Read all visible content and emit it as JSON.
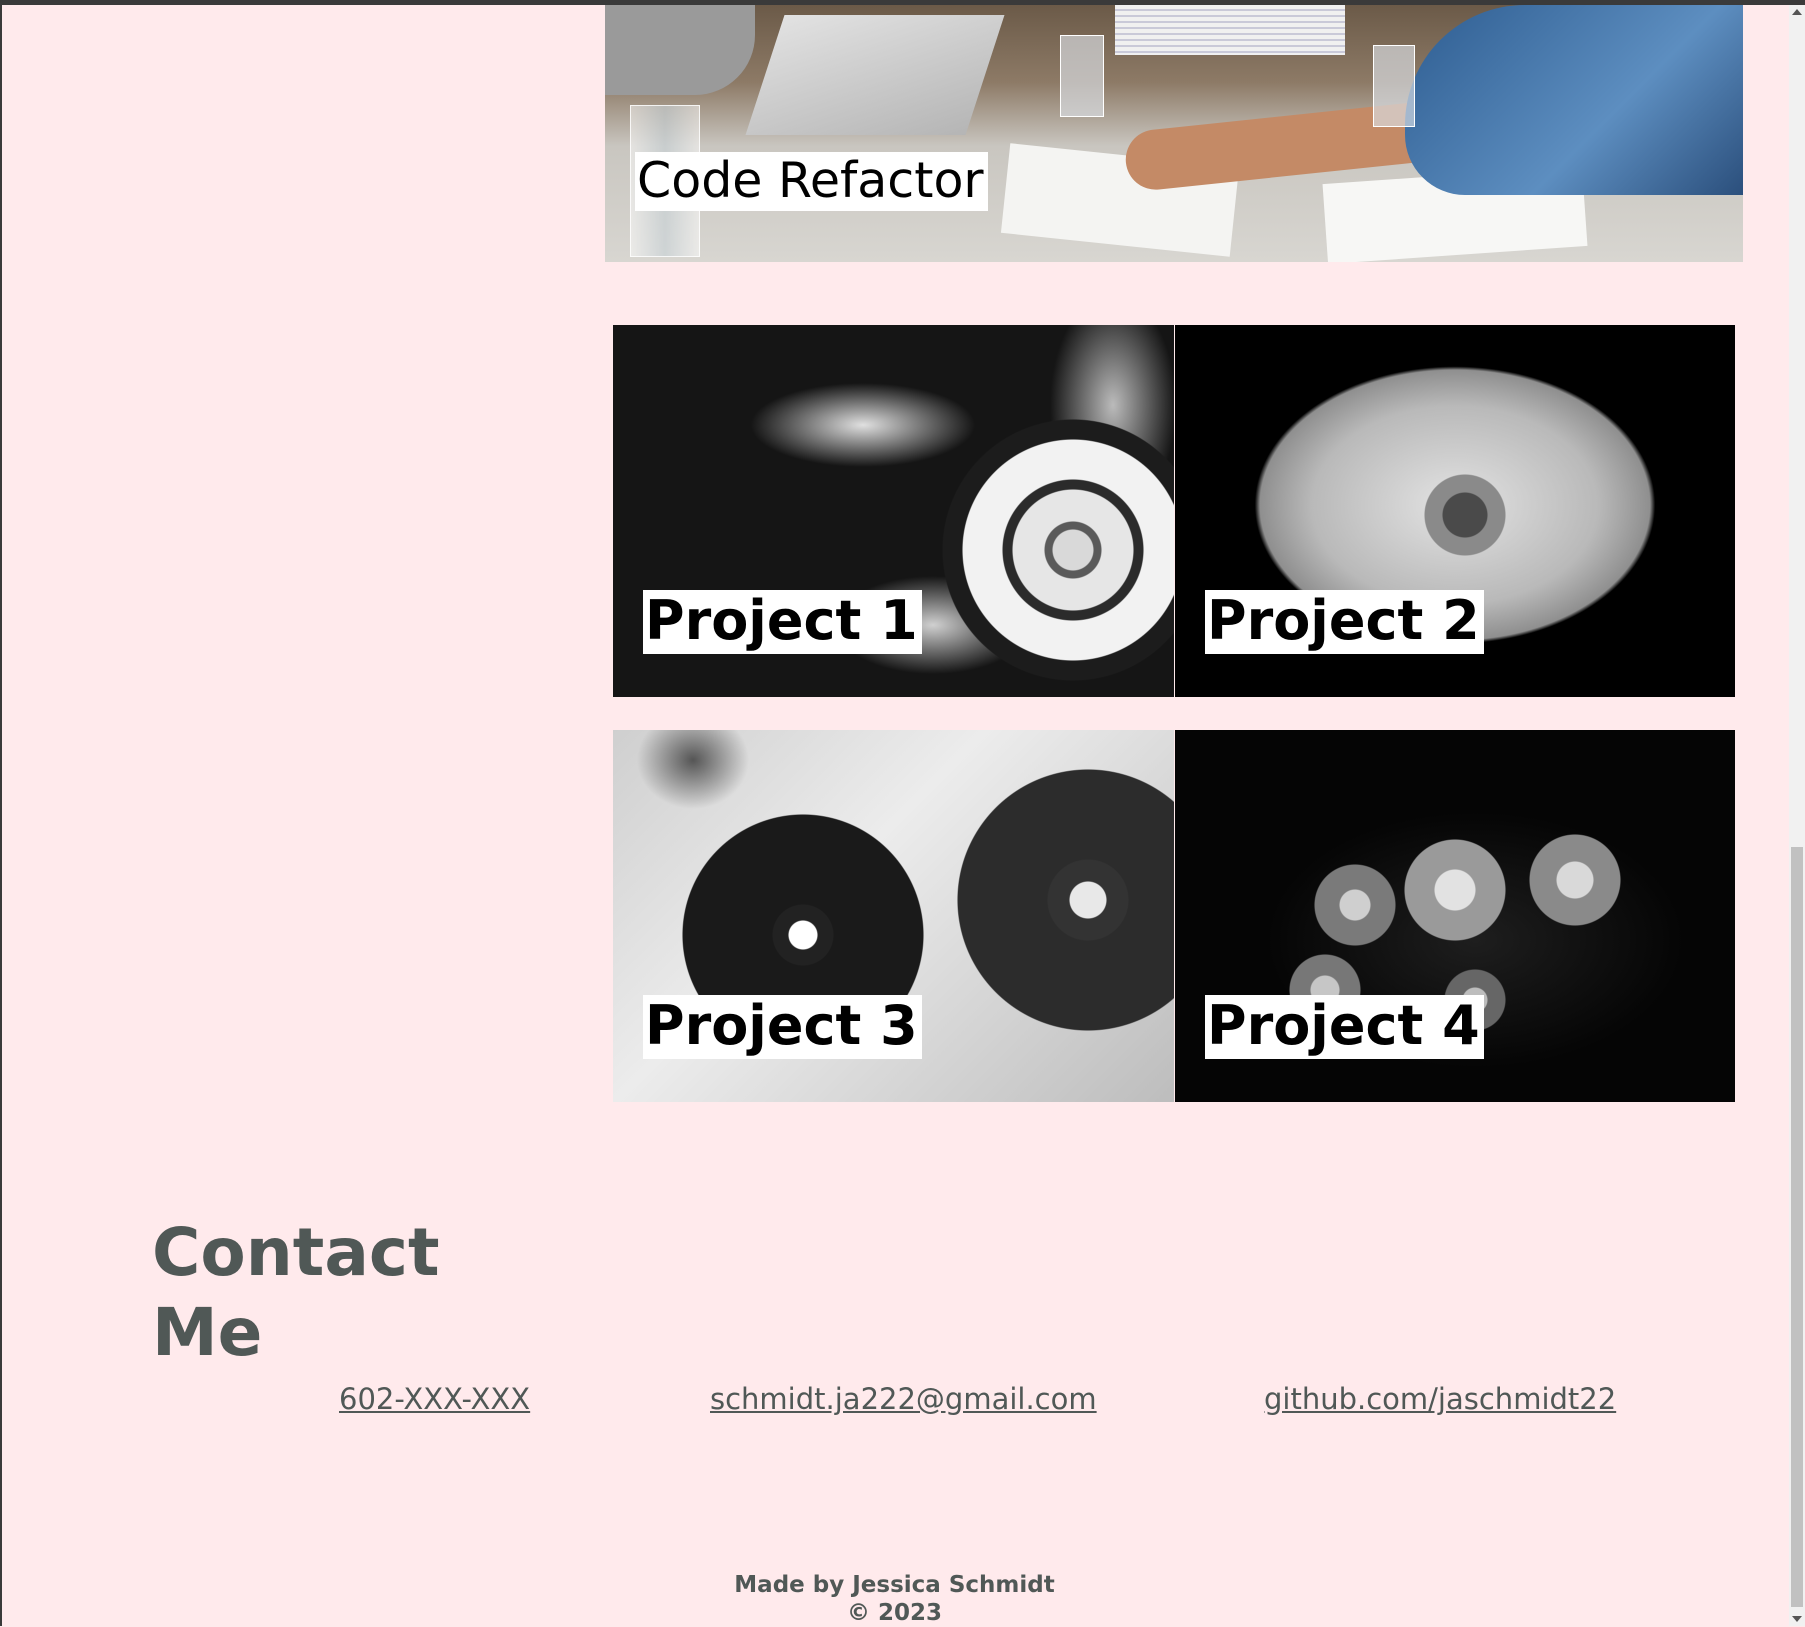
{
  "hero": {
    "label": "Code Refactor"
  },
  "projects": [
    {
      "label": "Project 1"
    },
    {
      "label": "Project 2"
    },
    {
      "label": "Project 3"
    },
    {
      "label": "Project 4"
    }
  ],
  "contact": {
    "heading": "Contact Me",
    "phone": "602-XXX-XXX",
    "email": "schmidt.ja222@gmail.com",
    "github": "github.com/jaschmidt22"
  },
  "footer": {
    "made_by": "Made by Jessica Schmidt",
    "copyright": "© 2023"
  },
  "colors": {
    "page_background": "#ffeaec",
    "text": "#505856",
    "label_background": "#ffffff"
  }
}
